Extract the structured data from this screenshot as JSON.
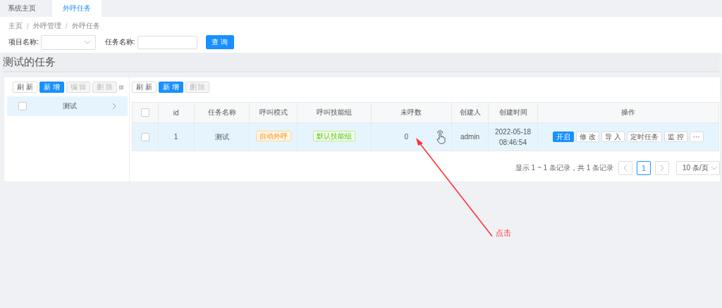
{
  "tabs": [
    {
      "label": "系统主页",
      "selected": false
    },
    {
      "label": "外呼任务",
      "selected": true
    }
  ],
  "breadcrumb": {
    "items": [
      "主页",
      "外呼管理",
      "外呼任务"
    ],
    "separator": "/"
  },
  "filters": {
    "project_label": "项目名称:",
    "task_label": "任务名称:",
    "query_button": "查 询"
  },
  "section_title": "测试的任务",
  "left_panel": {
    "toolbar": [
      {
        "label": "刷 新",
        "kind": "default",
        "disabled": false
      },
      {
        "label": "新 增",
        "kind": "primary",
        "disabled": false
      },
      {
        "label": "编 辑",
        "kind": "default",
        "disabled": true
      },
      {
        "label": "删 除",
        "kind": "default",
        "disabled": true
      }
    ],
    "items": [
      {
        "label": "测试",
        "selected": true,
        "checked": false
      }
    ]
  },
  "right_panel": {
    "toolbar": [
      {
        "label": "刷 新",
        "kind": "default",
        "disabled": false
      },
      {
        "label": "新 增",
        "kind": "primary",
        "disabled": false
      },
      {
        "label": "删 除",
        "kind": "default",
        "disabled": true
      }
    ],
    "table": {
      "header_checked": false,
      "columns": [
        "id",
        "任务名称",
        "呼叫模式",
        "呼叫技能组",
        "未呼数",
        "创建人",
        "创建时间",
        "操作"
      ],
      "rows": [
        {
          "checked": false,
          "id": "1",
          "name": "测试",
          "mode": "自动外呼",
          "group": "默认技能组",
          "uncalled": "0",
          "creator": "admin",
          "created": [
            "2022-05-18",
            "08:46:54"
          ],
          "actions": [
            {
              "label": "开启",
              "kind": "primary"
            },
            {
              "label": "修 改",
              "kind": "default"
            },
            {
              "label": "导 入",
              "kind": "default"
            },
            {
              "label": "定时任务",
              "kind": "default"
            },
            {
              "label": "监 控",
              "kind": "default"
            },
            {
              "label": "···",
              "kind": "default"
            }
          ]
        }
      ]
    },
    "pagination": {
      "summary": "显示 1 ~ 1 条记录，共 1 条记录",
      "pages": [
        {
          "label": "1",
          "selected": true
        }
      ],
      "page_size": "10 条/页"
    }
  },
  "annotation": {
    "text": "点击"
  }
}
